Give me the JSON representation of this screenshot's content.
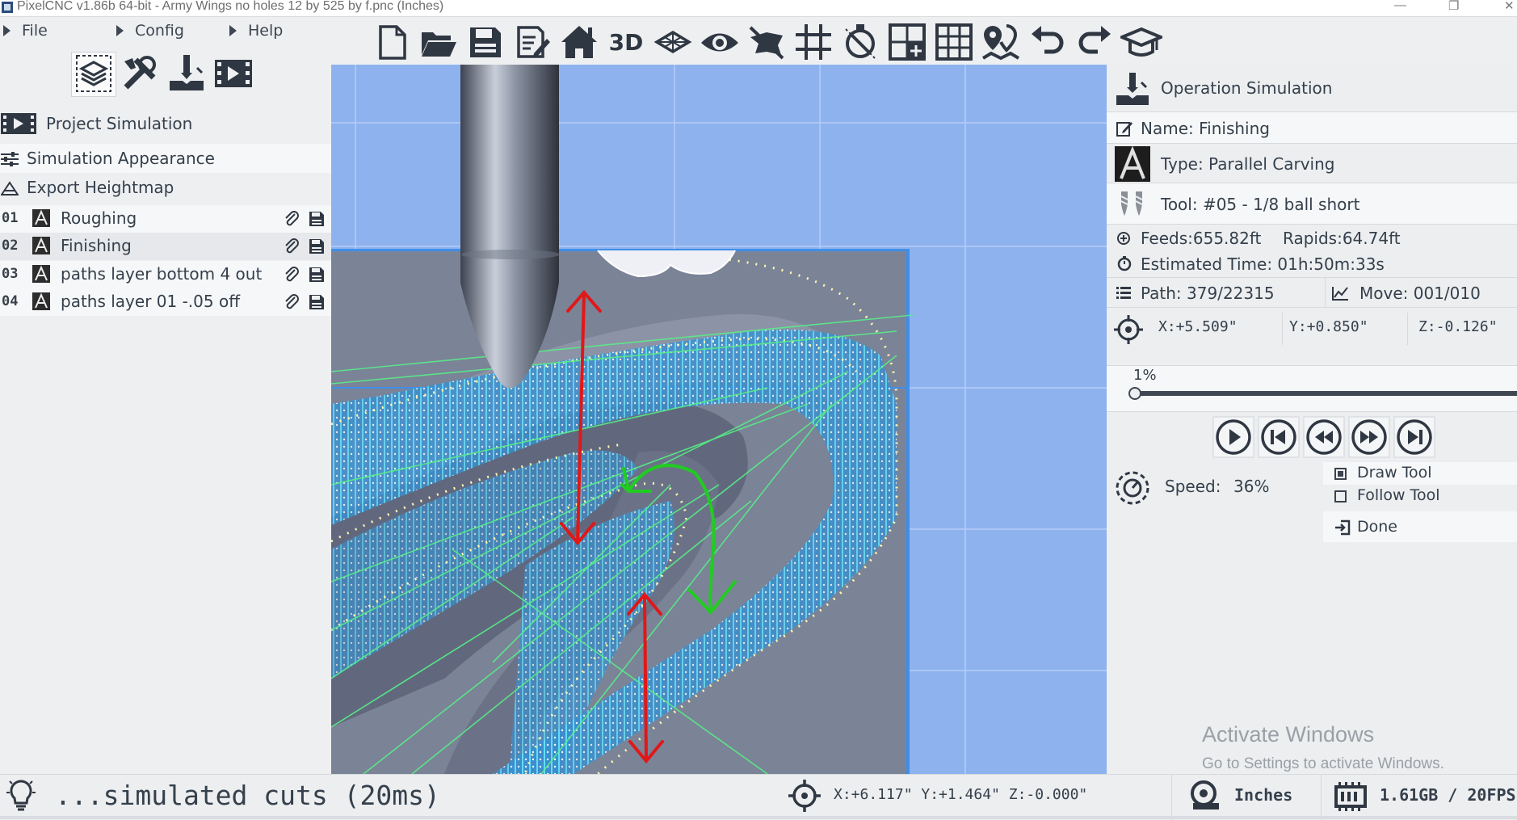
{
  "window": {
    "title": "PixelCNC v1.86b 64-bit  - Army Wings no holes 12 by 525 by f.pnc (Inches)",
    "minimize": "—",
    "maximize": "❐",
    "close": "✕"
  },
  "menu": {
    "file": "File",
    "config": "Config",
    "help": "Help"
  },
  "toolbar": {
    "icons": [
      "new-file-icon",
      "open-folder-icon",
      "save-icon",
      "edit-document-icon",
      "home-icon",
      "3d-view-icon",
      "layers-icon",
      "eye-icon",
      "hide-icon",
      "grid-icon",
      "no-tool-icon",
      "add-grid-icon",
      "table-grid-icon",
      "map-marker-icon",
      "undo-icon",
      "redo-icon",
      "graduate-cap-icon"
    ],
    "label_3d": "3D"
  },
  "left_panel": {
    "tools": [
      "layers-tool-icon",
      "tools-icon",
      "cnc-operation-icon",
      "simulation-film-icon"
    ],
    "project_simulation": "Project Simulation",
    "simulation_appearance": "Simulation Appearance",
    "export_heightmap": "Export Heightmap",
    "operations": [
      {
        "num": "01",
        "label": "Roughing"
      },
      {
        "num": "02",
        "label": "Finishing"
      },
      {
        "num": "03",
        "label": "paths layer bottom 4 out"
      },
      {
        "num": "04",
        "label": "paths layer 01 -.05 off"
      }
    ]
  },
  "right_panel": {
    "header": "Operation Simulation",
    "name": "Name: Finishing",
    "type": "Type: Parallel Carving",
    "tool": "Tool: #05 - 1/8 ball short",
    "feeds": "Feeds:655.82ft",
    "rapids": "Rapids:64.74ft",
    "estimated_time": "Estimated Time: 01h:50m:33s",
    "path": "Path: 379/22315",
    "move": "Move: 001/010",
    "coord_x": "X:+5.509\"",
    "coord_y": "Y:+0.850\"",
    "coord_z": "Z:-0.126\"",
    "progress_label": "1%",
    "progress": 0.01,
    "playback": [
      "play-icon",
      "skip-start-icon",
      "rewind-icon",
      "fast-forward-icon",
      "skip-end-icon"
    ],
    "speed_label": "Speed:",
    "speed_value": "36%",
    "draw_tool": "Draw Tool",
    "draw_tool_checked": true,
    "follow_tool": "Follow Tool",
    "follow_tool_checked": false,
    "done": "Done"
  },
  "status": {
    "message": "...simulated cuts (20ms)",
    "coords": "X:+6.117\" Y:+1.464\" Z:-0.000\"",
    "units": "Inches",
    "memory": "1.61GB / 20FPS"
  },
  "watermark": {
    "title": "Activate Windows",
    "subtitle": "Go to Settings to activate Windows."
  },
  "colors": {
    "viewport_bg": "#8eb2ee",
    "toolpath_blue": "#4fd8ff",
    "rapid_green": "#57ee88",
    "annotation_red": "#e01818",
    "annotation_green": "#21cc21",
    "material": "#7b8397"
  }
}
